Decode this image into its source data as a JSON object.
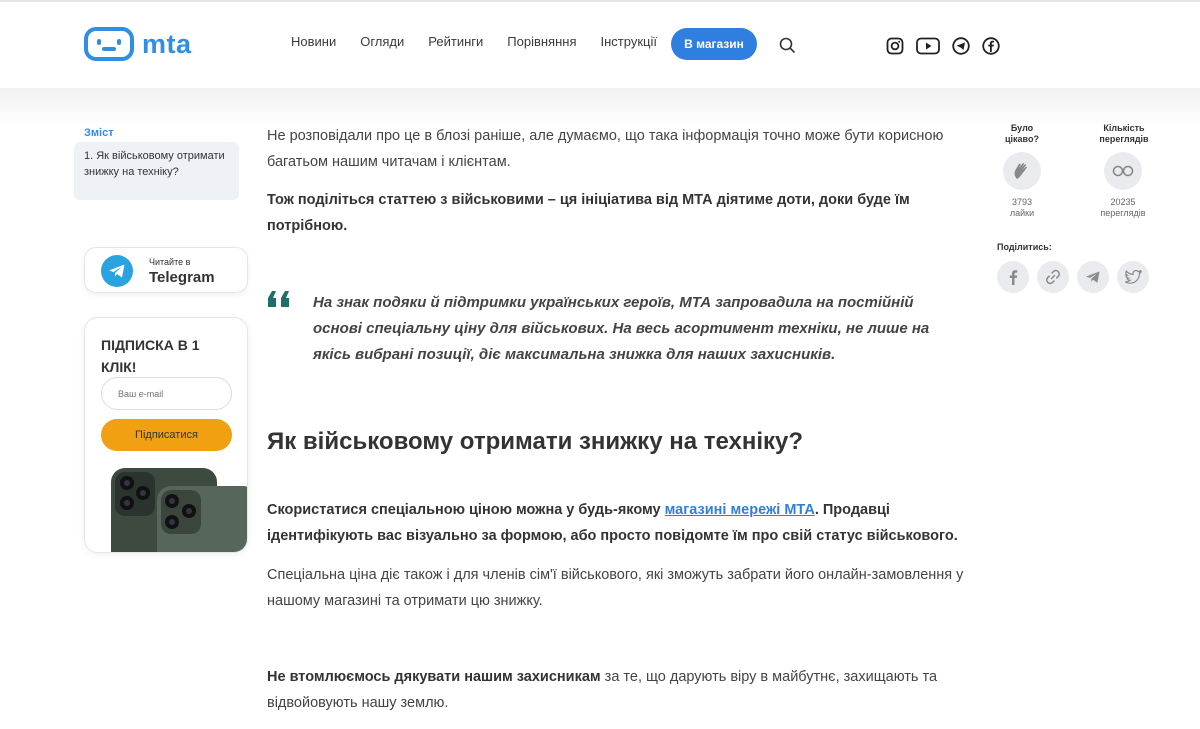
{
  "header": {
    "logo_text": "mta",
    "nav": [
      "Новини",
      "Огляди",
      "Рейтинги",
      "Порівняння",
      "Інструкції"
    ],
    "shop_button": "В магазин",
    "socials": [
      "instagram-icon",
      "youtube-icon",
      "telegram-icon",
      "facebook-icon"
    ]
  },
  "sidebar": {
    "toc_title": "Зміст",
    "toc_item": "1. Як військовому отримати знижку на техніку?",
    "telegram_small": "Читайте в",
    "telegram_big": "Telegram",
    "subscribe_title": "ПІДПИСКА В 1 КЛІК!",
    "email_placeholder": "Ваш e-mail",
    "subscribe_button": "Підписатися"
  },
  "article": {
    "p1": "Не розповідали про це в блозі раніше, але думаємо, що така інформація точно може бути корисною багатьом нашим читачам і клієнтам.",
    "p2": "Тож поділіться статтею з військовими – ця ініціатива від МТА діятиме доти, доки буде їм потрібною.",
    "quote": "На знак подяки й підтримки українських героїв, МТА запровадила на постійній основі спеціальну ціну для військових. На весь асортимент техніки, не лише на якісь вибрані позиції, діє максимальна знижка для наших захисників.",
    "heading": "Як військовому отримати знижку на техніку?",
    "p3_before": "Скористатися спеціальною ціною можна у будь-якому ",
    "p3_link": "магазині мережі МТА",
    "p3_after": ". Продавці ідентифікують вас візуально за формою, або просто повідомте їм про свій статус військового.",
    "p4": "Спеціальна ціна діє також і для членів сім'ї військового, які зможуть забрати його онлайн-замовлення у нашому магазині та отримати цю знижку.",
    "p5_bold": "Не втомлюємось дякувати нашим захисникам",
    "p5_rest": " за те, що дарують віру в майбутнє, захищають та відвойовують нашу землю."
  },
  "stats": {
    "likes_label": "Було цікаво?",
    "likes_count": "3793",
    "likes_unit": "лайки",
    "views_label": "Кількість переглядів",
    "views_count": "20235",
    "views_unit": "переглядів",
    "share_title": "Поділитись:"
  },
  "colors": {
    "brand": "#2f8fe3",
    "button": "#2f7fe0",
    "subscribe": "#f0a010",
    "quote_mark": "#1e6e6a"
  }
}
